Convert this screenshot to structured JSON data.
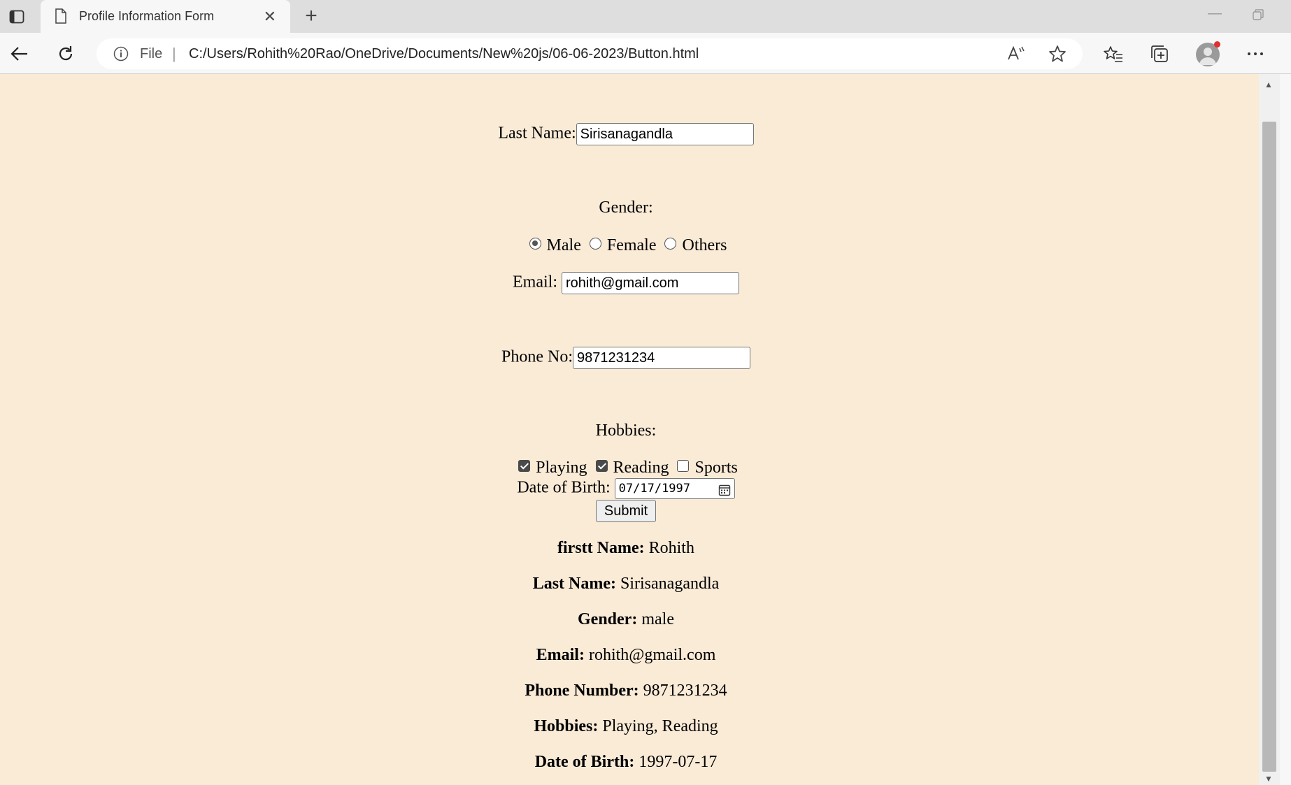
{
  "browser": {
    "tab_title": "Profile Information Form",
    "address": {
      "scheme_label": "File",
      "url": "C:/Users/Rohith%20Rao/OneDrive/Documents/New%20js/06-06-2023/Button.html"
    }
  },
  "form": {
    "last_name_label": "Last Name:",
    "last_name_value": "Sirisanagandla",
    "gender_label": "Gender:",
    "gender_options": [
      "Male",
      "Female",
      "Others"
    ],
    "gender_selected": "Male",
    "email_label": "Email:",
    "email_value": "rohith@gmail.com",
    "phone_label": "Phone No:",
    "phone_value": "9871231234",
    "hobbies_label": "Hobbies:",
    "hobbies_options": [
      "Playing",
      "Reading",
      "Sports"
    ],
    "hobbies_checked": [
      true,
      true,
      false
    ],
    "dob_label": "Date of Birth:",
    "dob_value": "07/17/1997",
    "submit_label": "Submit"
  },
  "result": {
    "first_name_label": "firstt Name:",
    "first_name_value": "Rohith",
    "last_name_label": "Last Name:",
    "last_name_value": "Sirisanagandla",
    "gender_label": "Gender:",
    "gender_value": "male",
    "email_label": "Email:",
    "email_value": "rohith@gmail.com",
    "phone_label": "Phone Number:",
    "phone_value": "9871231234",
    "hobbies_label": "Hobbies:",
    "hobbies_value": "Playing, Reading",
    "dob_label": "Date of Birth:",
    "dob_value": "1997-07-17"
  },
  "colors": {
    "page_background": "#faebd7",
    "profile_badge": "#e03030"
  }
}
